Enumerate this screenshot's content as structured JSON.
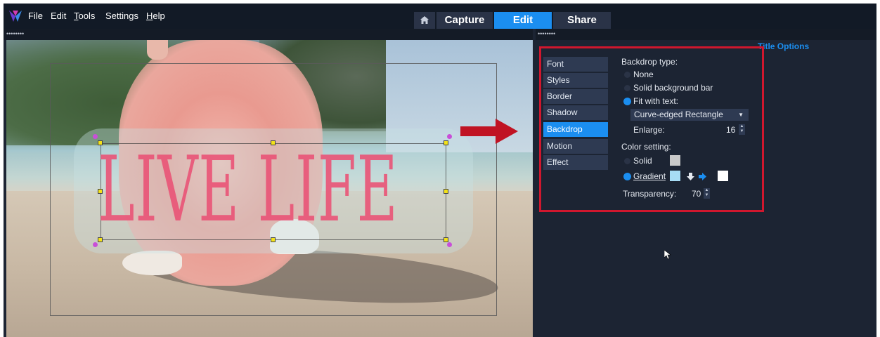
{
  "menu": {
    "items": [
      "File",
      "Edit",
      "Tools",
      "Settings",
      "Help"
    ]
  },
  "tabs": {
    "home_icon": "home-icon",
    "capture": "Capture",
    "edit": "Edit",
    "share": "Share",
    "active": "Edit"
  },
  "panel_grip": "••••••••",
  "preview": {
    "title_text": "LIVE LIFE"
  },
  "options": {
    "title": "Title Options",
    "categories": [
      "Font",
      "Styles",
      "Border",
      "Shadow",
      "Backdrop",
      "Motion",
      "Effect"
    ],
    "active_category": "Backdrop",
    "backdrop_type_label": "Backdrop type:",
    "radio_none": "None",
    "radio_solid_bar": "Solid background bar",
    "radio_fit_text": "Fit with text:",
    "selected_backdrop_type": "Fit with text:",
    "shape_select": "Curve-edged Rectangle",
    "enlarge_label": "Enlarge:",
    "enlarge_value": "16",
    "color_setting_label": "Color setting:",
    "color_solid": "Solid",
    "color_gradient": "Gradient",
    "selected_color_mode": "Gradient",
    "transparency_label": "Transparency:",
    "transparency_value": "70"
  },
  "colors": {
    "accent": "#1b8ef0",
    "highlight_box": "#d0172e",
    "title_text": "#ea5477",
    "solid_swatch": "#c8c8c8",
    "gradient_start": "#a7dcf5",
    "gradient_end": "#ffffff"
  }
}
